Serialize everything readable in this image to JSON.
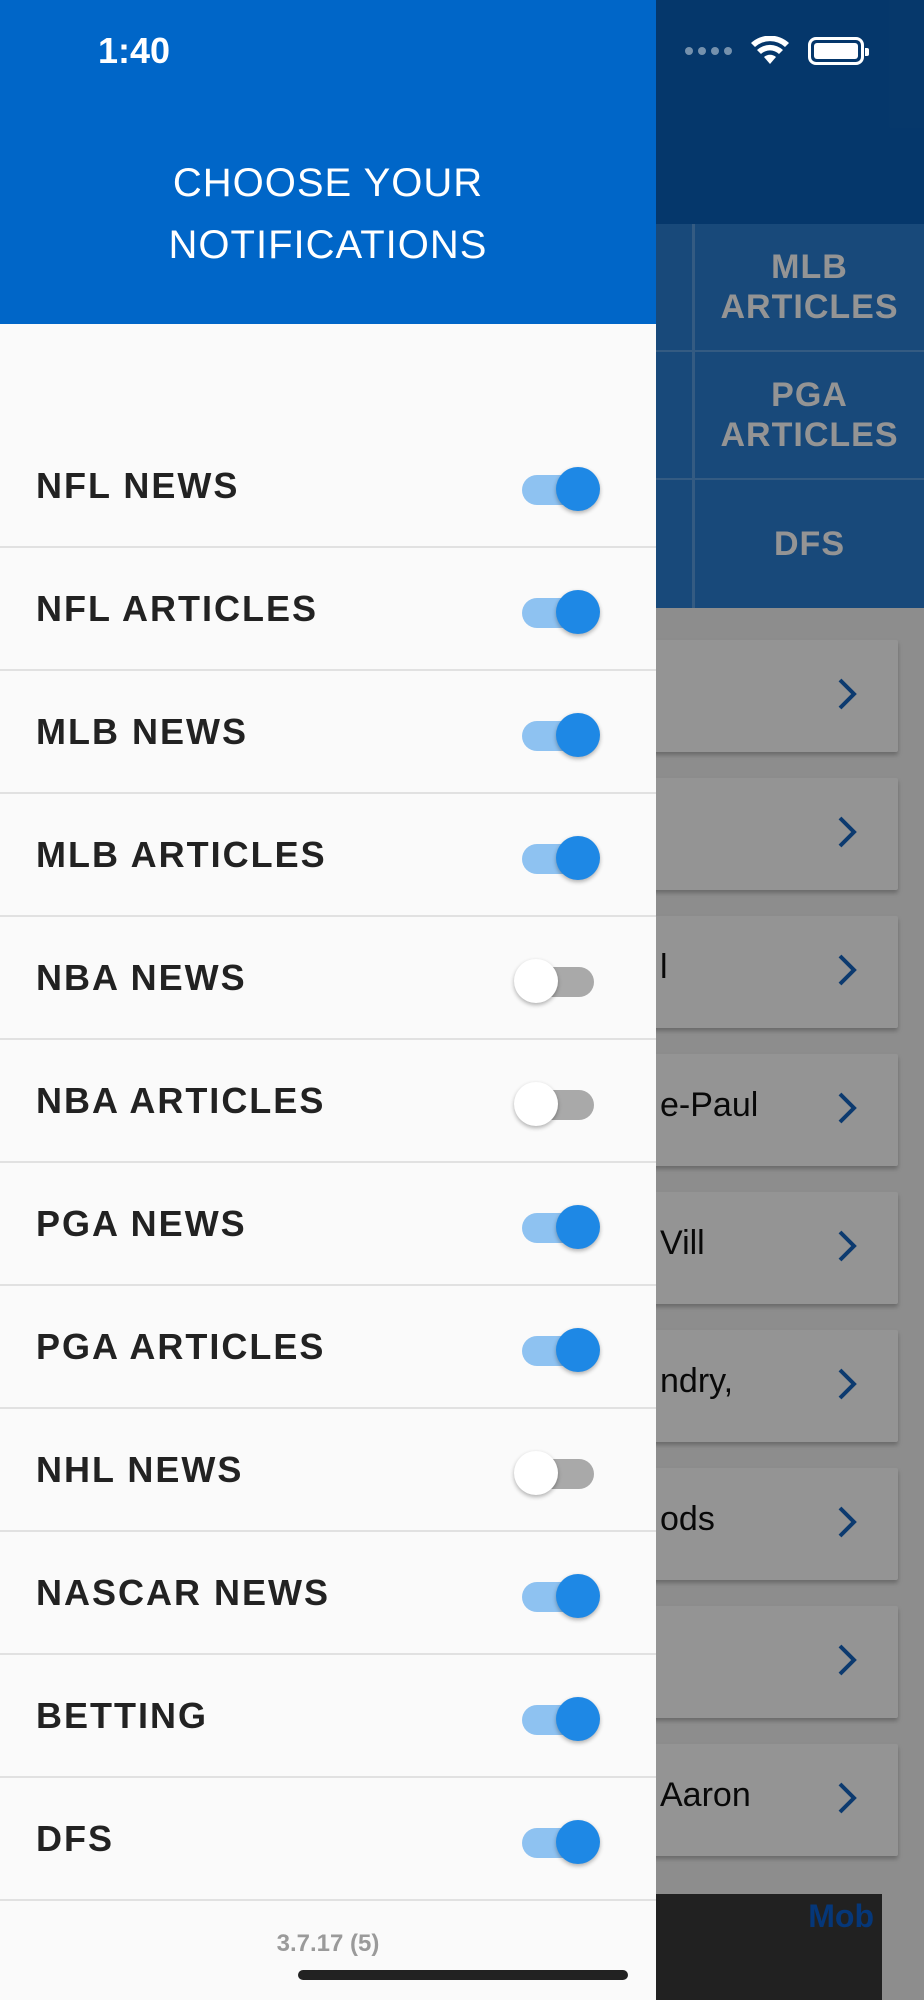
{
  "status_bar": {
    "time": "1:40"
  },
  "drawer": {
    "title_line1": "CHOOSE YOUR",
    "title_line2": "NOTIFICATIONS",
    "items": [
      {
        "label": "NFL NEWS",
        "enabled": true
      },
      {
        "label": "NFL ARTICLES",
        "enabled": true
      },
      {
        "label": "MLB NEWS",
        "enabled": true
      },
      {
        "label": "MLB ARTICLES",
        "enabled": true
      },
      {
        "label": "NBA NEWS",
        "enabled": false
      },
      {
        "label": "NBA ARTICLES",
        "enabled": false
      },
      {
        "label": "PGA NEWS",
        "enabled": true
      },
      {
        "label": "PGA ARTICLES",
        "enabled": true
      },
      {
        "label": "NHL NEWS",
        "enabled": false
      },
      {
        "label": "NASCAR NEWS",
        "enabled": true
      },
      {
        "label": "BETTING",
        "enabled": true
      },
      {
        "label": "DFS",
        "enabled": true
      }
    ],
    "version": "3.7.17 (5)"
  },
  "background": {
    "tabs": [
      "MLB ARTICLES",
      "PGA ARTICLES",
      "DFS"
    ],
    "card_snippets": [
      "",
      "",
      "l",
      "e-Paul",
      "Vill",
      "ndry,",
      "ods",
      "",
      "Aaron"
    ],
    "ad_badge": "Mob"
  },
  "colors": {
    "drawer_header": "#0066c8",
    "toggle_on": "#1e88e5",
    "toggle_on_track": "#8ec2f1",
    "toggle_off_track": "#a9a9a9"
  }
}
